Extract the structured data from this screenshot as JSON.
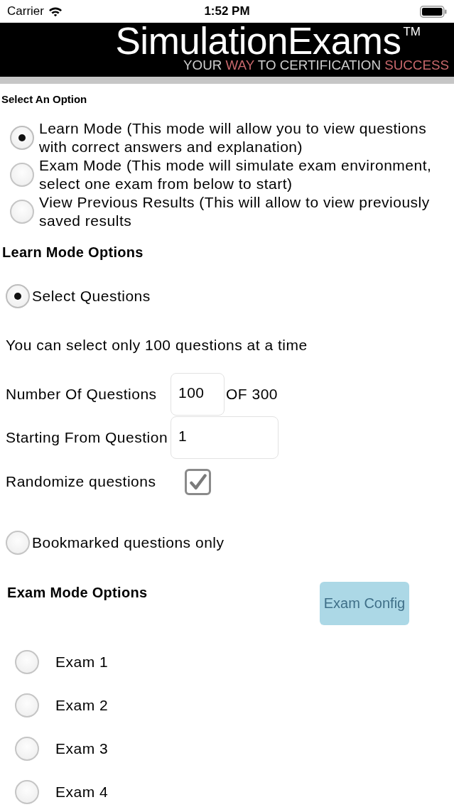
{
  "status_bar": {
    "carrier": "Carrier",
    "time": "1:52 PM"
  },
  "banner": {
    "title": "SimulationExams$^{TM}$",
    "tagline": [
      {
        "text": "YOUR",
        "highlight": false
      },
      {
        "text": "WAY",
        "highlight": true
      },
      {
        "text": "TO CERTIFICATION",
        "highlight": false
      },
      {
        "text": "SUCCESS",
        "highlight": true
      }
    ]
  },
  "prompt": "Select An Option",
  "modes": [
    {
      "label": "Learn Mode (This mode will allow you to view questions with correct answers and explanation)",
      "selected": true
    },
    {
      "label": "Exam Mode (This mode will simulate exam environment, select one exam from below to start)",
      "selected": false
    },
    {
      "label": "View Previous Results (This will allow to view previously saved results",
      "selected": false
    }
  ],
  "learn_options": {
    "title": "Learn Mode Options",
    "select_questions": {
      "label": "Select Questions",
      "selected": true
    },
    "note": "You can select only 100 questions at a time",
    "fields": [
      {
        "label": "Number Of Questions",
        "value": "100",
        "suffix": "OF 300"
      },
      {
        "label": "Starting From Question",
        "value": "1"
      }
    ],
    "randomize": {
      "label": "Randomize questions",
      "checked": true
    },
    "bookmarked": {
      "label": "Bookmarked questions only",
      "selected": false
    }
  },
  "exam_options": {
    "title": "Exam Mode Options",
    "config_button": {
      "label": "Exam Config",
      "disabled": true
    },
    "exams": [
      {
        "label": "Exam 1",
        "selected": false
      },
      {
        "label": "Exam 2",
        "selected": false
      },
      {
        "label": "Exam 3",
        "selected": false
      },
      {
        "label": "Exam 4",
        "selected": false
      }
    ]
  }
}
